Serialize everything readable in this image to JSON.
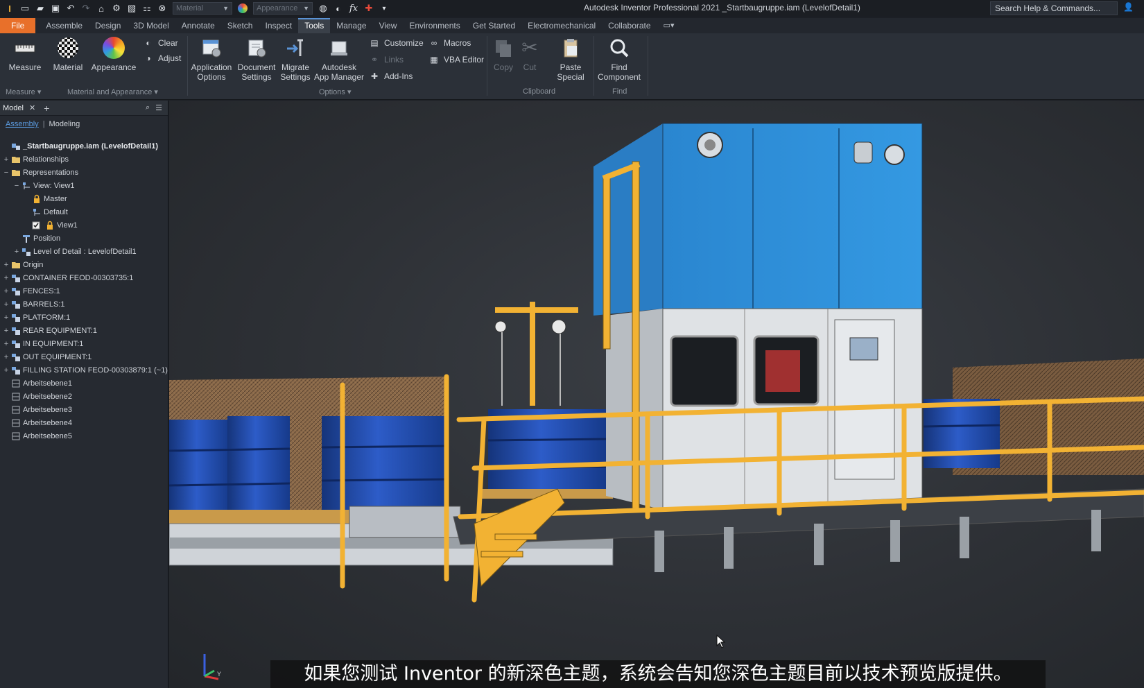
{
  "titlebar": {
    "app_title": "Autodesk Inventor Professional 2021   _Startbaugruppe.iam (LevelofDetail1)",
    "material_placeholder": "Material",
    "appearance_placeholder": "Appearance",
    "search_label": "Search Help & Commands..."
  },
  "menu": {
    "tabs": [
      "File",
      "Assemble",
      "Design",
      "3D Model",
      "Annotate",
      "Sketch",
      "Inspect",
      "Tools",
      "Manage",
      "View",
      "Environments",
      "Get Started",
      "Electromechanical",
      "Collaborate"
    ],
    "active": "Tools"
  },
  "ribbon": {
    "measure": "Measure",
    "material": "Material",
    "appearance": "Appearance",
    "clear": "Clear",
    "adjust": "Adjust",
    "app_options_1": "Application",
    "app_options_2": "Options",
    "doc_settings_1": "Document",
    "doc_settings_2": "Settings",
    "migrate_1": "Migrate",
    "migrate_2": "Settings",
    "app_manager_1": "Autodesk",
    "app_manager_2": "App Manager",
    "customize": "Customize",
    "links": "Links",
    "addins": "Add-Ins",
    "macros": "Macros",
    "vba": "VBA Editor",
    "copy": "Copy",
    "cut": "Cut",
    "paste_special_1": "Paste",
    "paste_special_2": "Special",
    "find_component_1": "Find",
    "find_component_2": "Component",
    "groups": {
      "measure": "Measure",
      "material": "Material and Appearance",
      "options": "Options",
      "clipboard": "Clipboard",
      "find": "Find"
    }
  },
  "browser": {
    "tab": "Model",
    "sub_assembly": "Assembly",
    "sub_modeling": "Modeling",
    "tree": [
      {
        "label": "_Startbaugruppe.iam (LevelofDetail1)",
        "indent": 0,
        "exp": "",
        "icon": "assembly"
      },
      {
        "label": "Relationships",
        "indent": 0,
        "exp": "+",
        "icon": "folder"
      },
      {
        "label": "Representations",
        "indent": 0,
        "exp": "−",
        "icon": "folder"
      },
      {
        "label": "View: View1",
        "indent": 1,
        "exp": "−",
        "icon": "view"
      },
      {
        "label": "Master",
        "indent": 2,
        "exp": "",
        "icon": "lock"
      },
      {
        "label": "Default",
        "indent": 2,
        "exp": "",
        "icon": "view"
      },
      {
        "label": "View1",
        "indent": 2,
        "exp": "",
        "icon": "check-lock"
      },
      {
        "label": "Position",
        "indent": 1,
        "exp": "",
        "icon": "position"
      },
      {
        "label": "Level of Detail : LevelofDetail1",
        "indent": 1,
        "exp": "+",
        "icon": "lod"
      },
      {
        "label": "Origin",
        "indent": 0,
        "exp": "+",
        "icon": "folder"
      },
      {
        "label": "CONTAINER FEOD-00303735:1",
        "indent": 0,
        "exp": "+",
        "icon": "part"
      },
      {
        "label": "FENCES:1",
        "indent": 0,
        "exp": "+",
        "icon": "part"
      },
      {
        "label": "BARRELS:1",
        "indent": 0,
        "exp": "+",
        "icon": "part"
      },
      {
        "label": "PLATFORM:1",
        "indent": 0,
        "exp": "+",
        "icon": "part"
      },
      {
        "label": "REAR EQUIPMENT:1",
        "indent": 0,
        "exp": "+",
        "icon": "part"
      },
      {
        "label": "IN EQUIPMENT:1",
        "indent": 0,
        "exp": "+",
        "icon": "part"
      },
      {
        "label": "OUT EQUIPMENT:1",
        "indent": 0,
        "exp": "+",
        "icon": "part"
      },
      {
        "label": "FILLING STATION FEOD-00303879:1 (~1)",
        "indent": 0,
        "exp": "+",
        "icon": "part"
      },
      {
        "label": "Arbeitsebene1",
        "indent": 0,
        "exp": "",
        "icon": "plane"
      },
      {
        "label": "Arbeitsebene2",
        "indent": 0,
        "exp": "",
        "icon": "plane"
      },
      {
        "label": "Arbeitsebene3",
        "indent": 0,
        "exp": "",
        "icon": "plane"
      },
      {
        "label": "Arbeitsebene4",
        "indent": 0,
        "exp": "",
        "icon": "plane"
      },
      {
        "label": "Arbeitsebene5",
        "indent": 0,
        "exp": "",
        "icon": "plane"
      }
    ]
  },
  "viewport": {
    "subtitle": "如果您测试 Inventor 的新深色主题，系统会告知您深色主题目前以技术预览版提供。",
    "axis_y": "Y"
  },
  "colors": {
    "file_tab": "#e8702a",
    "machine_blue": "#2f8fd8",
    "rail_yellow": "#f2b233",
    "barrel_blue": "#1f4aa8",
    "link_blue": "#5b9be0"
  }
}
